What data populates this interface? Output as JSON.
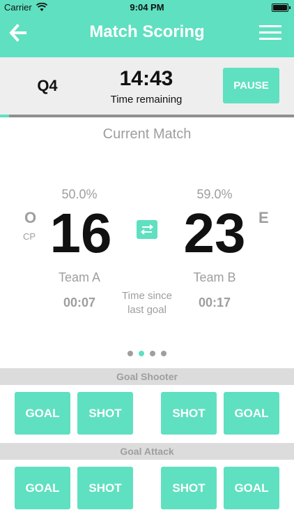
{
  "status_bar": {
    "carrier": "Carrier",
    "time": "9:04 PM"
  },
  "nav": {
    "title": "Match Scoring",
    "back_icon": "arrow-left-icon",
    "menu_icon": "hamburger-menu-icon"
  },
  "timer": {
    "quarter": "Q4",
    "clock": "14:43",
    "label": "Time  remaining",
    "pause_label": "PAUSE",
    "quarter_progress": 0.03
  },
  "match": {
    "title": "Current Match",
    "team_a": {
      "percentage": "50.0%",
      "score": "16",
      "position_main": "O",
      "position_sub": "CP",
      "name": "Team A",
      "time_since_goal": "00:07"
    },
    "team_b": {
      "percentage": "59.0%",
      "score": "23",
      "position_main": "E",
      "name": "Team B",
      "time_since_goal": "00:17"
    },
    "time_since_label_line1": "Time since",
    "time_since_label_line2": "last goal",
    "swap_icon": "swap-arrows-icon"
  },
  "pager": {
    "count": 4,
    "active_index": 1
  },
  "positions": [
    {
      "name": "Goal Shooter",
      "buttons": [
        "GOAL",
        "SHOT",
        "SHOT",
        "GOAL"
      ]
    },
    {
      "name": "Goal Attack",
      "buttons": [
        "GOAL",
        "SHOT",
        "SHOT",
        "GOAL"
      ]
    }
  ],
  "colors": {
    "accent": "#5fe0c0",
    "muted_text": "#9e9e9e",
    "header_grey": "#dcdcdc",
    "timer_bg": "#eeeeee"
  }
}
